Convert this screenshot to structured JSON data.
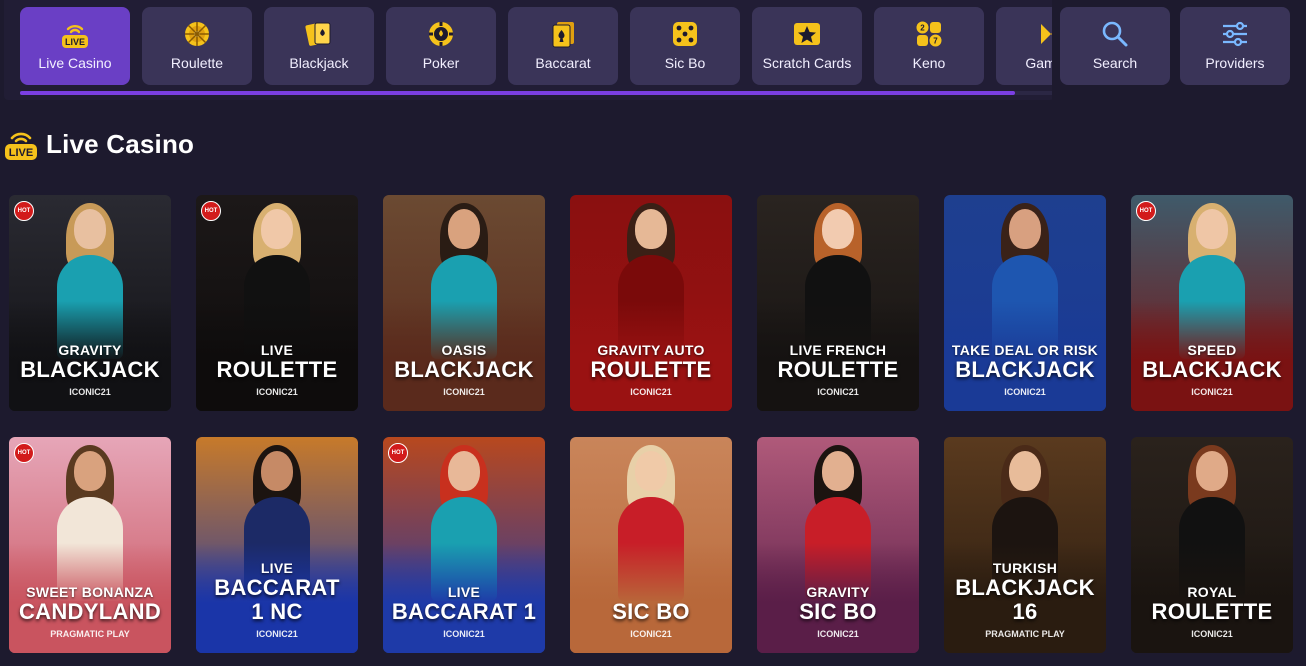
{
  "categories": [
    {
      "label": "Live Casino",
      "icon": "live-icon",
      "active": true
    },
    {
      "label": "Roulette",
      "icon": "roulette-icon"
    },
    {
      "label": "Blackjack",
      "icon": "cards-icon"
    },
    {
      "label": "Poker",
      "icon": "poker-chip-icon"
    },
    {
      "label": "Baccarat",
      "icon": "spade-cards-icon"
    },
    {
      "label": "Sic Bo",
      "icon": "dice-icon"
    },
    {
      "label": "Scratch Cards",
      "icon": "star-ticket-icon"
    },
    {
      "label": "Keno",
      "icon": "keno-balls-icon"
    },
    {
      "label": "Game S",
      "icon": "game-shows-icon"
    }
  ],
  "scroll_progress": 0.96,
  "actions": {
    "search_label": "Search",
    "providers_label": "Providers"
  },
  "section": {
    "title": "Live Casino",
    "badge": "LIVE"
  },
  "hot_badge": "HOT",
  "games": [
    {
      "sub": "GRAVITY",
      "main": [
        "BLACKJACK"
      ],
      "provider": "ICONIC21",
      "hot": true,
      "bg": "#2a2a32",
      "fade": "#111114"
    },
    {
      "sub": "LIVE",
      "main": [
        "ROULETTE"
      ],
      "provider": "ICONIC21",
      "hot": true,
      "bg": "#1c1818",
      "fade": "#0e0c0c"
    },
    {
      "sub": "OASIS",
      "main": [
        "BLACKJACK"
      ],
      "provider": "ICONIC21",
      "hot": false,
      "bg": "#6b4a32",
      "fade": "#5a2a1c"
    },
    {
      "sub": "GRAVITY AUTO",
      "main": [
        "ROULETTE"
      ],
      "provider": "ICONIC21",
      "hot": false,
      "bg": "#8a1010",
      "fade": "#9a1212"
    },
    {
      "sub": "LIVE FRENCH",
      "main": [
        "ROULETTE"
      ],
      "provider": "ICONIC21",
      "hot": false,
      "bg": "#2a2420",
      "fade": "#151211"
    },
    {
      "sub": "TAKE DEAL OR RISK",
      "main": [
        "BLACKJACK"
      ],
      "provider": "ICONIC21",
      "hot": false,
      "bg": "#1e3f8f",
      "fade": "#1a3a96"
    },
    {
      "sub": "SPEED",
      "main": [
        "BLACKJACK"
      ],
      "provider": "ICONIC21",
      "hot": true,
      "bg": "#3f5a6a",
      "fade": "#7a1212"
    },
    {
      "sub": "SWEET BONANZA",
      "main": [
        "CANDYLAND"
      ],
      "provider": "PRAGMATIC PLAY",
      "hot": true,
      "bg": "#e6a6b8",
      "fade": "#c9545f"
    },
    {
      "sub": "LIVE",
      "main": [
        "BACCARAT",
        "1 NC"
      ],
      "provider": "ICONIC21",
      "hot": false,
      "bg": "#c77a2a",
      "fade": "#1a35a8"
    },
    {
      "sub": "LIVE",
      "main": [
        "BACCARAT 1"
      ],
      "provider": "ICONIC21",
      "hot": true,
      "bg": "#b8481e",
      "fade": "#1e3aa8"
    },
    {
      "sub": "",
      "main": [
        "SIC BO"
      ],
      "provider": "ICONIC21",
      "hot": false,
      "bg": "#c9855a",
      "fade": "#b8683a"
    },
    {
      "sub": "GRAVITY",
      "main": [
        "SIC BO"
      ],
      "provider": "ICONIC21",
      "hot": false,
      "bg": "#b05a7a",
      "fade": "#5a1e48"
    },
    {
      "sub": "TURKISH",
      "main": [
        "BLACKJACK 16"
      ],
      "provider": "PRAGMATIC PLAY",
      "hot": false,
      "bg": "#5a3a1e",
      "fade": "#2a1c10"
    },
    {
      "sub": "ROYAL",
      "main": [
        "ROULETTE"
      ],
      "provider": "ICONIC21",
      "hot": false,
      "bg": "#2a221c",
      "fade": "#1a1410"
    }
  ]
}
